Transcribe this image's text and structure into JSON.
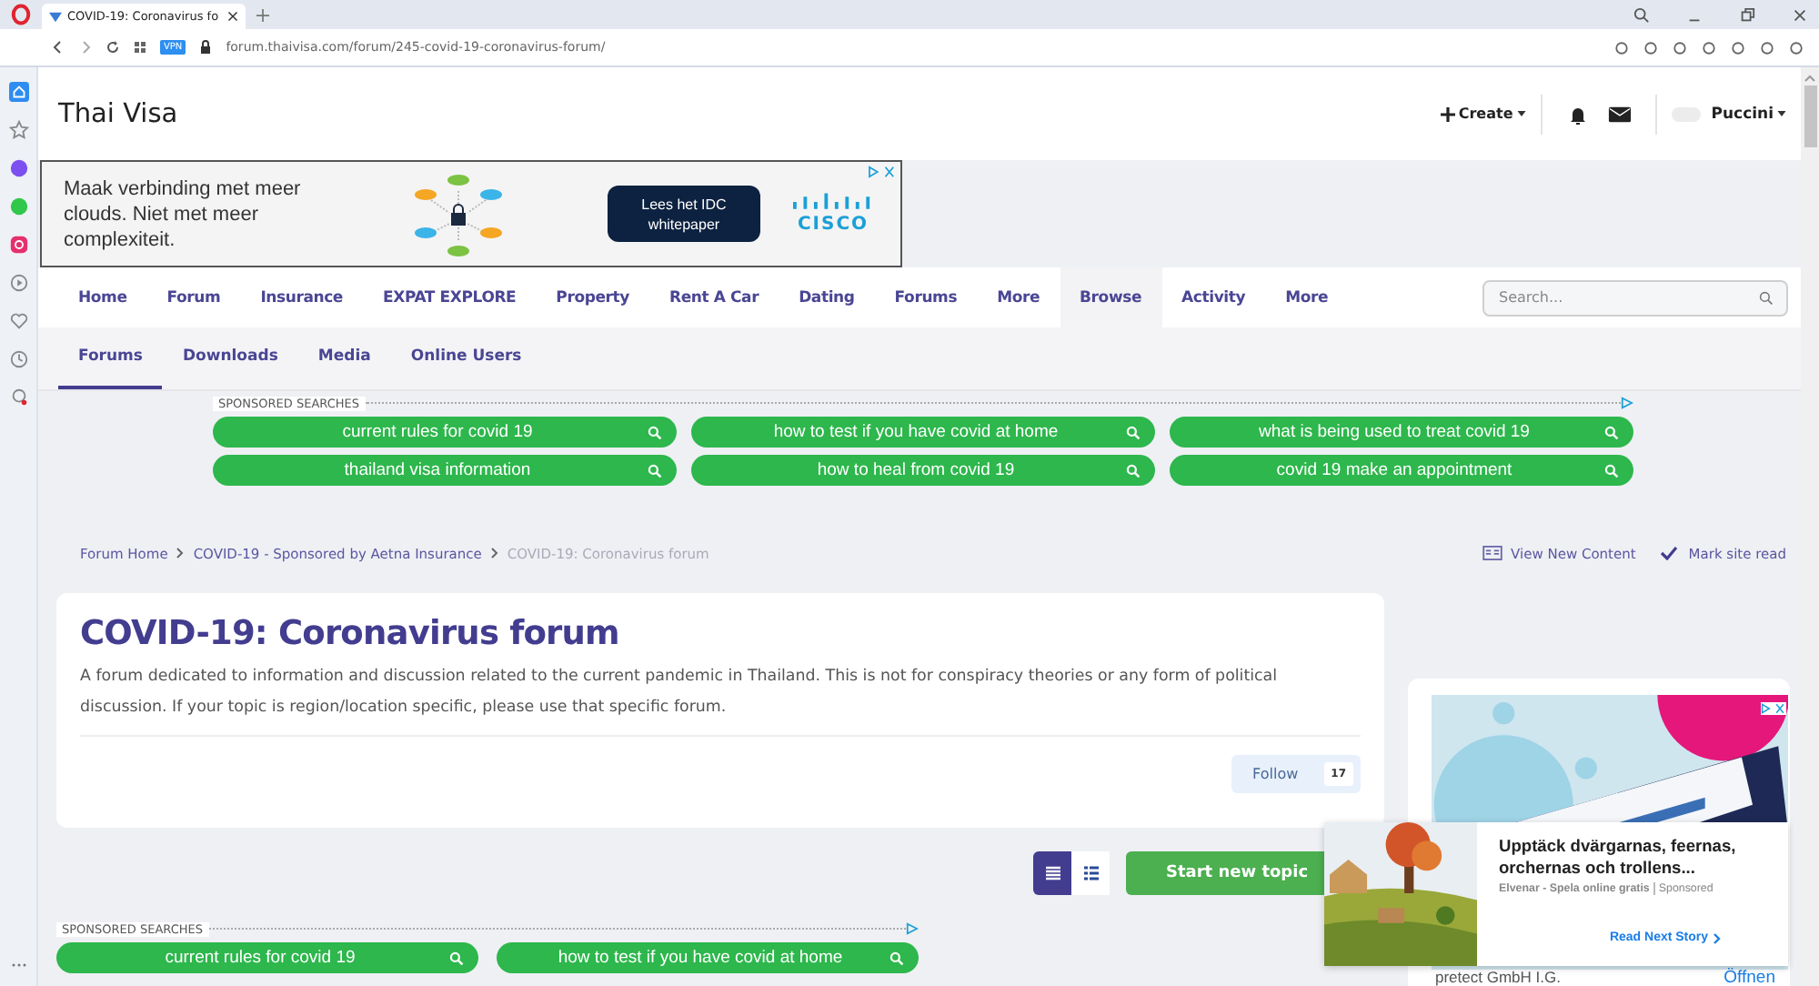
{
  "browser": {
    "tab_title": "COVID-19: Coronavirus fo",
    "url": "forum.thaivisa.com/forum/245-covid-19-coronavirus-forum/",
    "vpn_badge": "VPN"
  },
  "site": {
    "logo": "Thai Visa",
    "create": "Create",
    "user": "Puccini"
  },
  "ad_banner": {
    "text": "Maak verbinding met meer clouds. Niet met meer complexiteit.",
    "button": "Lees het IDC whitepaper",
    "brand": "CISCO"
  },
  "nav": [
    {
      "label": "Home",
      "selected": false
    },
    {
      "label": "Forum",
      "selected": false
    },
    {
      "label": "Insurance",
      "selected": false
    },
    {
      "label": "EXPAT EXPLORE",
      "selected": false
    },
    {
      "label": "Property",
      "selected": false
    },
    {
      "label": "Rent A Car",
      "selected": false
    },
    {
      "label": "Dating",
      "selected": false
    },
    {
      "label": "Forums",
      "selected": false
    },
    {
      "label": "More",
      "selected": false
    },
    {
      "label": "Browse",
      "selected": true
    },
    {
      "label": "Activity",
      "selected": false
    },
    {
      "label": "More",
      "selected": false
    }
  ],
  "search": {
    "placeholder": "Search..."
  },
  "subnav": [
    {
      "label": "Forums",
      "selected": true
    },
    {
      "label": "Downloads",
      "selected": false
    },
    {
      "label": "Media",
      "selected": false
    },
    {
      "label": "Online Users",
      "selected": false
    }
  ],
  "sponsored_top": {
    "label": "SPONSORED SEARCHES",
    "chips": [
      "current rules for covid 19",
      "how to test if you have covid at home",
      "what is being used to treat covid 19",
      "thailand visa information",
      "how to heal from covid 19",
      "covid 19 make an appointment"
    ]
  },
  "breadcrumb": [
    "Forum Home",
    "COVID-19 - Sponsored by Aetna Insurance",
    "COVID-19: Coronavirus forum"
  ],
  "page_actions": [
    "View New Content",
    "Mark site read"
  ],
  "forum": {
    "title": "COVID-19: Coronavirus forum",
    "description": "A forum dedicated to information and discussion related to the current pandemic in Thailand. This is not for conspiracy theories or any form of political discussion. If your topic is region/location specific, please use that specific forum.",
    "follow": "Follow",
    "follow_count": "17"
  },
  "view_toggle": [
    {
      "kind": "rows",
      "selected": true
    },
    {
      "kind": "list",
      "selected": false
    }
  ],
  "start_topic": "Start new topic",
  "sponsored_bottom": {
    "label": "SPONSORED SEARCHES",
    "chips": [
      "current rules for covid 19",
      "how to test if you have covid at home"
    ]
  },
  "side_ad": {
    "kind": "picture",
    "footer_text": "pretect GmbH I.G.",
    "footer_link": "Öffnen"
  },
  "popup": {
    "title": "Upptäck dvärgarnas, feernas, orchernas och trollens...",
    "source": "Elvenar - Spela online gratis",
    "sponsored": "Sponsored",
    "link": "Read Next Story"
  }
}
